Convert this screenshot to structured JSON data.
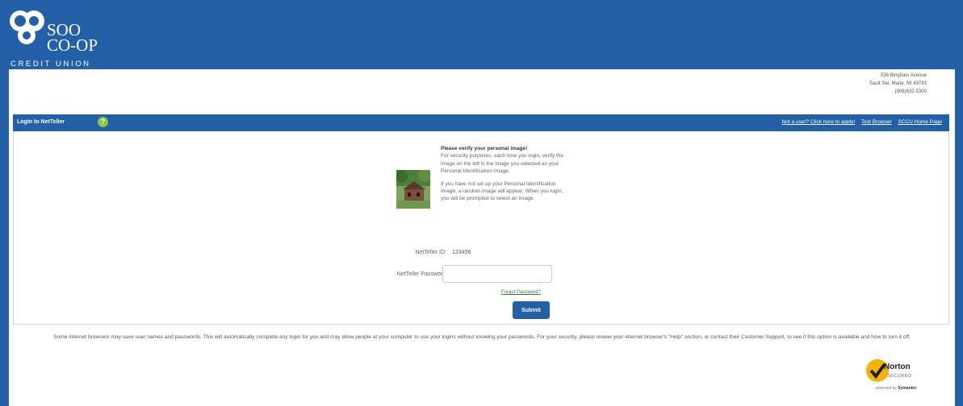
{
  "header": {
    "logo_line1": "SOO",
    "logo_line2": "CO-OP",
    "logo_line3": "CREDIT UNION"
  },
  "address": {
    "street": "536 Bingham Avenue",
    "city": "Sault Ste. Marie, MI 49783",
    "phone": "(906)632-5300"
  },
  "titlebar": {
    "title": "Login to NetTeller",
    "help_symbol": "?",
    "links": [
      "Not a user? Click here to apply!",
      "Test Browser",
      "SCCU Home Page"
    ]
  },
  "verify": {
    "title": "Please verify your personal image!",
    "para1": "For security purposes, each time you login, verify the image on the left is the image you selected as your Personal Identification Image.",
    "para2": "If you have not set up your Personal Identification Image, a random image will appear. When you login, you will be prompted to select an image."
  },
  "form": {
    "id_label": "NetTeller ID:",
    "id_value": "123456",
    "password_label": "NetTeller Password:",
    "password_value": "",
    "forgot_label": "Forgot Password?",
    "submit_label": "Submit"
  },
  "disclaimer": "Some internet browsers may save user names and passwords. This will automatically complete any login for you and may allow people at your computer to use your logins without knowing your passwords. For your security, please review your internet browser's \"Help\" section, or contact their Customer Support, to see if this option is available and how to turn it off.",
  "norton": {
    "brand": "Norton",
    "secured": "SECURED",
    "powered_prefix": "powered by",
    "powered_brand": "Symantec"
  },
  "colors": {
    "brand_blue": "#2460a7",
    "help_green": "#8dc63f",
    "norton_yellow": "#f5b300"
  },
  "icons": [
    "logo-mark-icon",
    "help-icon",
    "personal-image",
    "norton-check-icon"
  ]
}
